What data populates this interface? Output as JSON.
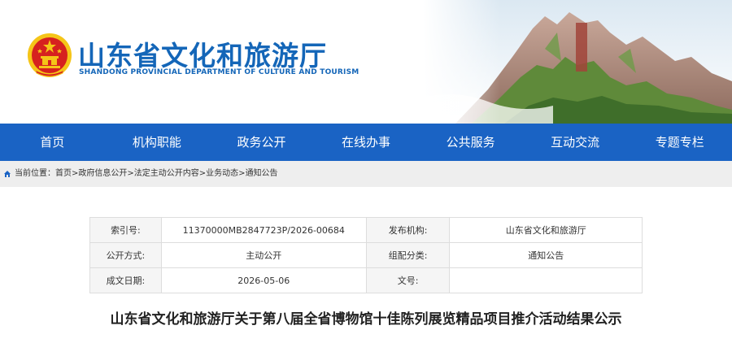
{
  "header": {
    "title": "山东省文化和旅游厅",
    "subtitle": "SHANDONG PROVINCIAL DEPARTMENT OF CULTURE AND  TOURISM"
  },
  "nav": {
    "items": [
      "首页",
      "机构职能",
      "政务公开",
      "在线办事",
      "公共服务",
      "互动交流",
      "专题专栏"
    ]
  },
  "breadcrumb": {
    "prefix": "当前位置：",
    "items": [
      "首页",
      "政府信息公开",
      "法定主动公开内容",
      "业务动态",
      "通知公告"
    ],
    "separator": ">"
  },
  "info": {
    "index_label": "索引号:",
    "index_value": "11370000MB2847723P/2026-00684",
    "publisher_label": "发布机构:",
    "publisher_value": "山东省文化和旅游厅",
    "disclosure_label": "公开方式:",
    "disclosure_value": "主动公开",
    "category_label": "组配分类:",
    "category_value": "通知公告",
    "date_label": "成文日期:",
    "date_value": "2026-05-06",
    "doc_no_label": "文号:",
    "doc_no_value": ""
  },
  "article": {
    "title": "山东省文化和旅游厅关于第八届全省博物馆十佳陈列展览精品项目推介活动结果公示"
  },
  "colors": {
    "brand_blue": "#1466b8",
    "nav_blue": "#1a63c4",
    "emblem_red": "#d6211f",
    "emblem_gold": "#f5c518"
  }
}
